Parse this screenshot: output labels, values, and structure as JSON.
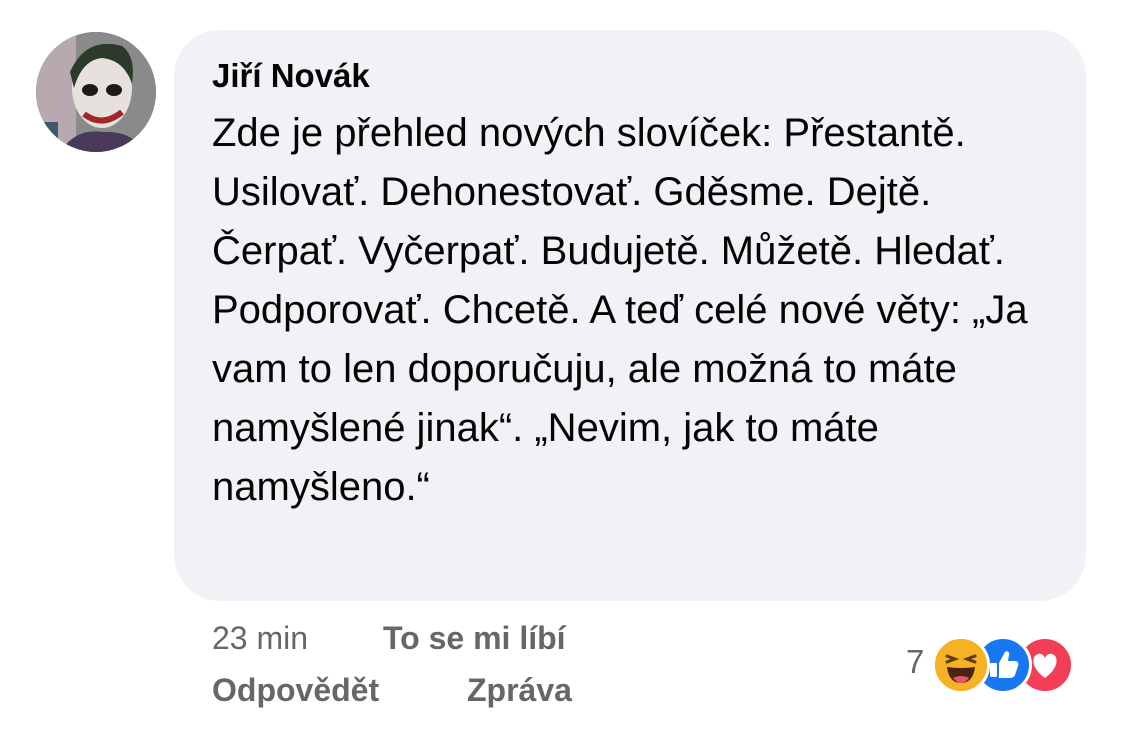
{
  "comment": {
    "author": "Jiří Novák",
    "text": "Zde je přehled nových slovíček: Přestantě. Usilovať. Dehonestovať. Gděsme. Dejtě. Čerpať. Vyčerpať. Budujetě. Můžetě. Hledať. Podporovať. Chcetě. A teď celé nové věty: „Ja vam to len doporučuju, ale možná to máte namyšlené jinak“. „Nevim, jak to máte namyšleno.“"
  },
  "meta": {
    "time": "23 min",
    "like_label": "To se mi líbí",
    "reply_label": "Odpovědět",
    "message_label": "Zpráva"
  },
  "reactions": {
    "count": "7",
    "icons": [
      "haha-icon",
      "like-icon",
      "love-icon"
    ]
  },
  "colors": {
    "bubble": "#f0f2f5",
    "secondary_text": "#65676b",
    "like_blue": "#1877f2",
    "love_red": "#f33e58",
    "haha_yellow": "#f7b125"
  }
}
